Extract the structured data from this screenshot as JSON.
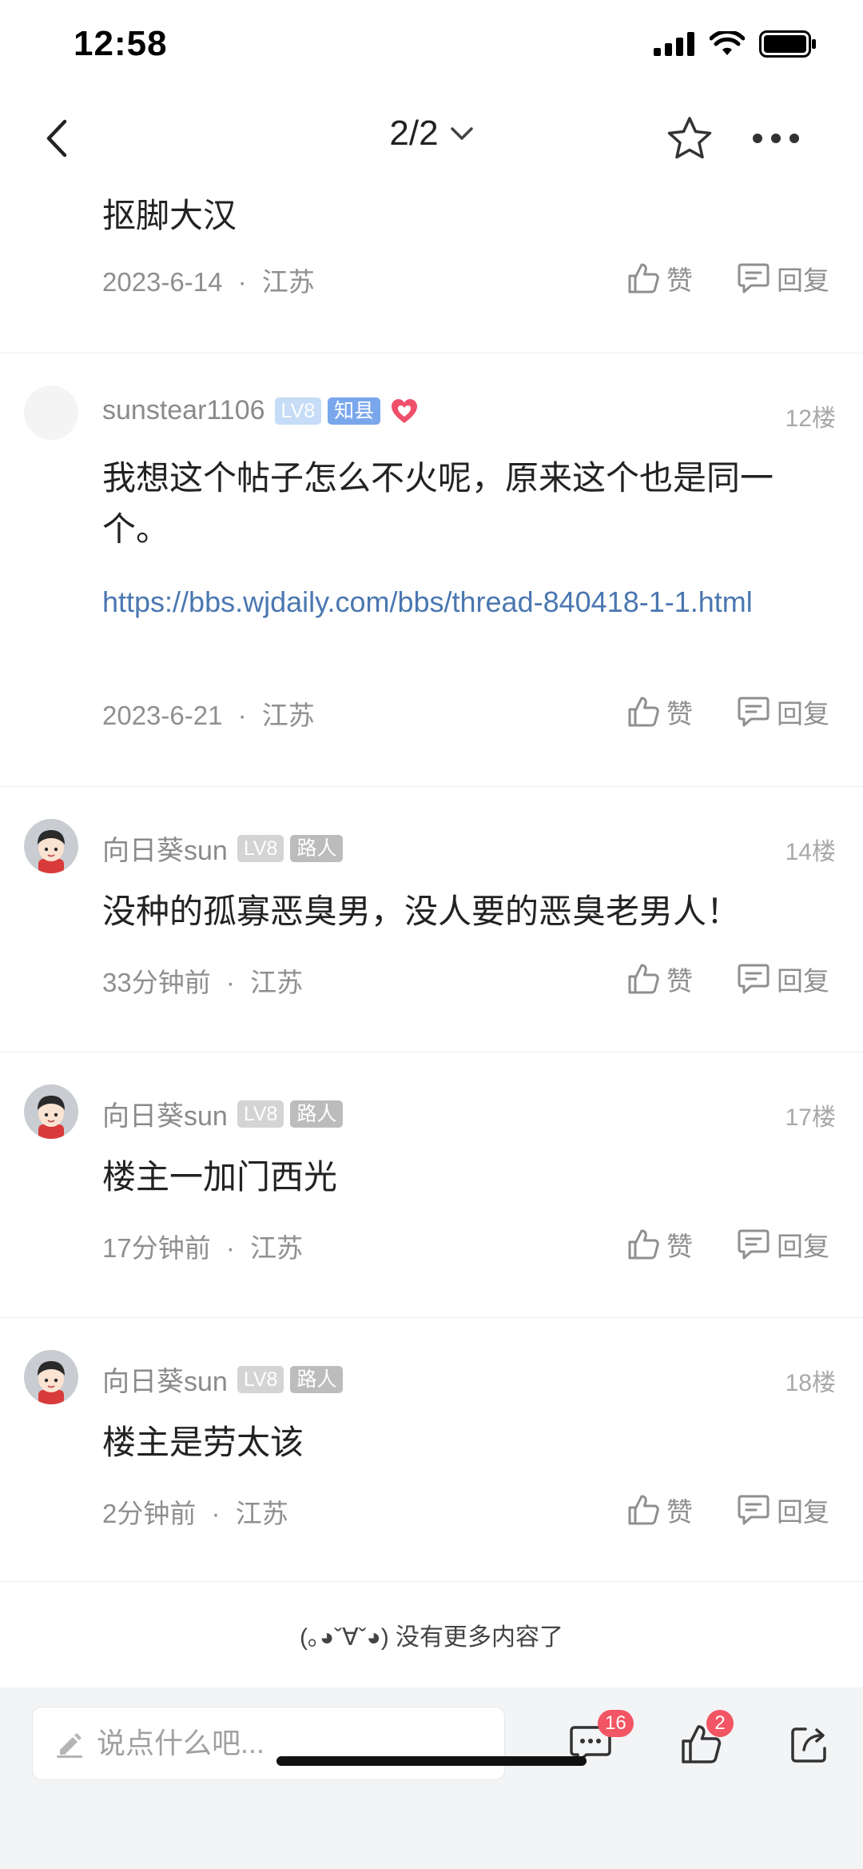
{
  "status_bar": {
    "time": "12:58"
  },
  "nav": {
    "page_indicator": "2/2"
  },
  "comments": [
    {
      "text": "抠脚大汉",
      "date": "2023-6-14",
      "location": "江苏",
      "like_label": "赞",
      "reply_label": "回复"
    },
    {
      "username": "sunstear1106",
      "level": "LV8",
      "role": "知县",
      "floor": "12楼",
      "text": "我想这个帖子怎么不火呢，原来这个也是同一个。",
      "link": "https://bbs.wjdaily.com/bbs/thread-840418-1-1.html",
      "date": "2023-6-21",
      "location": "江苏",
      "like_label": "赞",
      "reply_label": "回复"
    },
    {
      "username": "向日葵sun",
      "level": "LV8",
      "role": "路人",
      "floor": "14楼",
      "text": "没种的孤寡恶臭男，没人要的恶臭老男人！",
      "date": "33分钟前",
      "location": "江苏",
      "like_label": "赞",
      "reply_label": "回复"
    },
    {
      "username": "向日葵sun",
      "level": "LV8",
      "role": "路人",
      "floor": "17楼",
      "text": "楼主一加门西光",
      "date": "17分钟前",
      "location": "江苏",
      "like_label": "赞",
      "reply_label": "回复"
    },
    {
      "username": "向日葵sun",
      "level": "LV8",
      "role": "路人",
      "floor": "18楼",
      "text": "楼主是劳太该",
      "date": "2分钟前",
      "location": "江苏",
      "like_label": "赞",
      "reply_label": "回复"
    }
  ],
  "meta_separator": "·",
  "end_note": "(｡◕ˇ∀ˇ◕)  没有更多内容了",
  "bottom_bar": {
    "input_placeholder": "说点什么吧...",
    "comment_count": "16",
    "like_count": "2"
  },
  "colors": {
    "link": "#4a77b0",
    "badge_red": "#f25563",
    "role_blue": "#7aa7ec",
    "heart": "#f0506a"
  }
}
